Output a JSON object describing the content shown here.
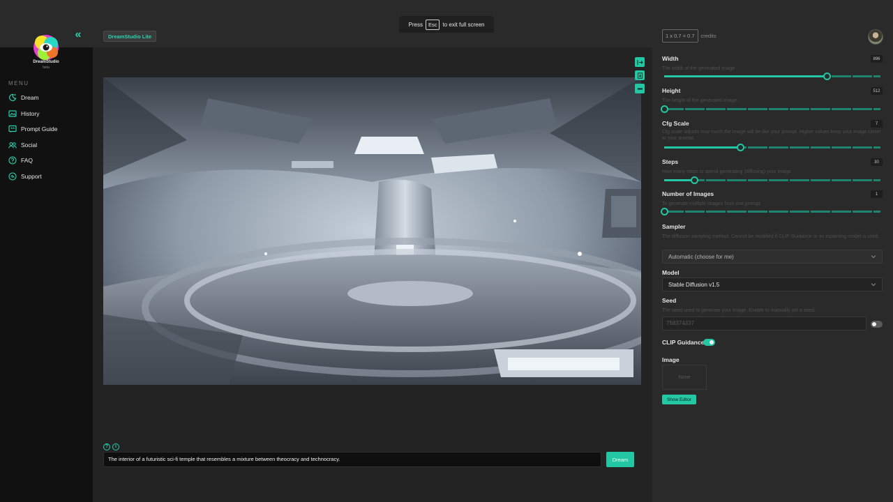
{
  "fullscreen_banner": {
    "press": "Press",
    "key": "Esc",
    "rest": "to exit full screen"
  },
  "header": {
    "brand_badge": "DreamStudio Lite",
    "credits_value": "1 x 0.7 = 0.7",
    "credits_label": "credits"
  },
  "sidebar": {
    "logo_name": "DreamStudio",
    "logo_sub": "beta",
    "menu_label": "MENU",
    "items": [
      {
        "label": "Dream",
        "icon": "dream-icon"
      },
      {
        "label": "History",
        "icon": "history-icon"
      },
      {
        "label": "Prompt Guide",
        "icon": "prompt-guide-icon"
      },
      {
        "label": "Social",
        "icon": "social-icon"
      },
      {
        "label": "FAQ",
        "icon": "faq-icon"
      },
      {
        "label": "Support",
        "icon": "support-icon"
      }
    ]
  },
  "main": {
    "image_alt": "Generated image",
    "image_tools": [
      "expand-icon",
      "download-icon",
      "remove-icon"
    ],
    "prompt_text": "The interior of a futuristic sci-fi temple that resembles a mixture between theocracy and technocracy.",
    "dream_button": "Dream"
  },
  "settings": {
    "width": {
      "label": "Width",
      "desc": "The width of the generated image.",
      "value": "896",
      "fraction": 0.75
    },
    "height": {
      "label": "Height",
      "desc": "The height of the generated image.",
      "value": "512",
      "fraction": 0.0
    },
    "cfg": {
      "label": "Cfg Scale",
      "desc": "Cfg scale adjusts how much the image will be like your prompt. Higher values keep your image closer to your prompt.",
      "value": "7",
      "fraction": 0.35
    },
    "steps": {
      "label": "Steps",
      "desc": "How many steps to spend generating (diffusing) your image.",
      "value": "30",
      "fraction": 0.14
    },
    "num_images": {
      "label": "Number of Images",
      "desc": "To generate multiple images from one prompt.",
      "value": "1",
      "fraction": 0.0
    },
    "sampler": {
      "label": "Sampler",
      "desc": "The diffusion sampling method. Cannot be modified if CLIP Guidance or an inpainting model is used.",
      "value": "Automatic (choose for me)"
    },
    "model": {
      "label": "Model",
      "value": "Stable Diffusion v1.5"
    },
    "seed": {
      "label": "Seed",
      "desc": "The seed used to generate your image. Enable to manually set a seed.",
      "value": "758374337",
      "enabled": false
    },
    "clip": {
      "label": "CLIP Guidance",
      "enabled": true
    },
    "image": {
      "label": "Image",
      "value": "None",
      "show_editor": "Show Editor"
    }
  },
  "colors": {
    "accent": "#24c7a3",
    "panel": "#2a2a2a",
    "sidebar": "#111111"
  }
}
